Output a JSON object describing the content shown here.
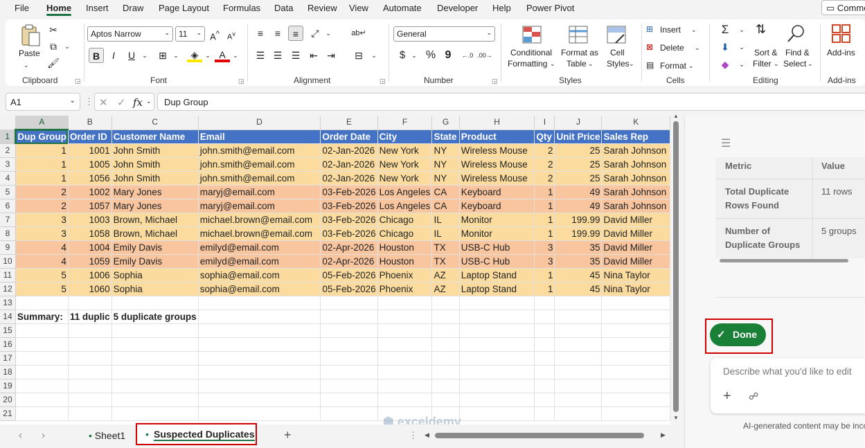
{
  "menu": {
    "tabs": [
      "File",
      "Home",
      "Insert",
      "Draw",
      "Page Layout",
      "Formulas",
      "Data",
      "Review",
      "View",
      "Automate",
      "Developer",
      "Help",
      "Power Pivot"
    ],
    "active": "Home",
    "comments_label": "Comments"
  },
  "ribbon": {
    "clipboard": {
      "label": "Clipboard",
      "paste": "Paste"
    },
    "font": {
      "label": "Font",
      "font_name": "Aptos Narrow",
      "font_size": "11",
      "bold": "B",
      "italic": "I",
      "underline": "U"
    },
    "alignment": {
      "label": "Alignment"
    },
    "number": {
      "label": "Number",
      "format": "General",
      "currency": "$",
      "percent": "%",
      "comma": "9"
    },
    "styles": {
      "label": "Styles",
      "conditional_1": "Conditional",
      "conditional_2": "Formatting",
      "format_as_1": "Format as",
      "format_as_2": "Table",
      "cell_styles_1": "Cell",
      "cell_styles_2": "Styles"
    },
    "cells": {
      "label": "Cells",
      "insert": "Insert",
      "delete": "Delete",
      "format": "Format"
    },
    "editing": {
      "label": "Editing",
      "sort_1": "Sort &",
      "sort_2": "Filter",
      "find_1": "Find &",
      "find_2": "Select"
    },
    "addins": {
      "label": "Add-ins",
      "button": "Add-ins"
    }
  },
  "formula_bar": {
    "name_box": "A1",
    "fx": "fx",
    "content": "Dup Group"
  },
  "sheet": {
    "columns": [
      "A",
      "B",
      "C",
      "D",
      "E",
      "F",
      "G",
      "H",
      "I",
      "J",
      "K"
    ],
    "header": [
      "Dup Group",
      "Order ID",
      "Customer Name",
      "Email",
      "Order Date",
      "City",
      "State",
      "Product",
      "Qty",
      "Unit Price",
      "Sales Rep"
    ],
    "rows": [
      [
        "1",
        "1001",
        "John Smith",
        "john.smith@email.com",
        "02-Jan-2026",
        "New York",
        "NY",
        "Wireless Mouse",
        "2",
        "25",
        "Sarah Johnson"
      ],
      [
        "1",
        "1005",
        "John Smith",
        "john.smith@email.com",
        "02-Jan-2026",
        "New York",
        "NY",
        "Wireless Mouse",
        "2",
        "25",
        "Sarah Johnson"
      ],
      [
        "1",
        "1056",
        "John Smith",
        "john.smith@email.com",
        "02-Jan-2026",
        "New York",
        "NY",
        "Wireless Mouse",
        "2",
        "25",
        "Sarah Johnson"
      ],
      [
        "2",
        "1002",
        "Mary Jones",
        "maryj@email.com",
        "03-Feb-2026",
        "Los Angeles",
        "CA",
        "Keyboard",
        "1",
        "49",
        "Sarah Johnson"
      ],
      [
        "2",
        "1057",
        "Mary Jones",
        "maryj@email.com",
        "03-Feb-2026",
        "Los Angeles",
        "CA",
        "Keyboard",
        "1",
        "49",
        "Sarah Johnson"
      ],
      [
        "3",
        "1003",
        "Brown, Michael",
        "michael.brown@email.com",
        "03-Feb-2026",
        "Chicago",
        "IL",
        "Monitor",
        "1",
        "199.99",
        "David Miller"
      ],
      [
        "3",
        "1058",
        "Brown, Michael",
        "michael.brown@email.com",
        "03-Feb-2026",
        "Chicago",
        "IL",
        "Monitor",
        "1",
        "199.99",
        "David Miller"
      ],
      [
        "4",
        "1004",
        "Emily Davis",
        "emilyd@email.com",
        "02-Apr-2026",
        "Houston",
        "TX",
        "USB-C Hub",
        "3",
        "35",
        "David Miller"
      ],
      [
        "4",
        "1059",
        "Emily Davis",
        "emilyd@email.com",
        "02-Apr-2026",
        "Houston",
        "TX",
        "USB-C Hub",
        "3",
        "35",
        "David Miller"
      ],
      [
        "5",
        "1006",
        "Sophia",
        "sophia@email.com",
        "05-Feb-2026",
        "Phoenix",
        "AZ",
        "Laptop Stand",
        "1",
        "45",
        "Nina Taylor"
      ],
      [
        "5",
        "1060",
        "Sophia",
        "sophia@email.com",
        "05-Feb-2026",
        "Phoenix",
        "AZ",
        "Laptop Stand",
        "1",
        "45",
        "Nina Taylor"
      ]
    ],
    "row_numbers": [
      "1",
      "2",
      "3",
      "4",
      "5",
      "6",
      "7",
      "8",
      "9",
      "10",
      "11",
      "12",
      "13",
      "14",
      "15",
      "16",
      "17",
      "18",
      "19",
      "20",
      "21"
    ],
    "summary_label": "Summary:",
    "summary_rows": "11 duplic",
    "summary_groups": "5 duplicate groups",
    "colors": {
      "header": "#4472c4",
      "group_odd": "#fbdc9e",
      "group_even": "#f8c59f"
    }
  },
  "tabs": {
    "sheets": [
      "Sheet1",
      "Suspected Duplicates"
    ],
    "active": "Suspected Duplicates",
    "watermark": "exceldemy"
  },
  "pane": {
    "table_header": [
      "Metric",
      "Value"
    ],
    "table_rows": [
      [
        "Total Duplicate Rows Found",
        "11 rows"
      ],
      [
        "Number of Duplicate Groups",
        "5 groups"
      ]
    ],
    "done_label": "Done",
    "prompt_placeholder": "Describe what you'd like to edit",
    "disclaimer": "AI-generated content may be incorrect"
  }
}
